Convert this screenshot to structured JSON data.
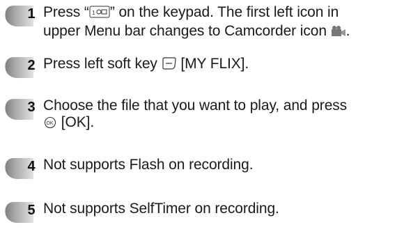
{
  "steps": [
    {
      "number": "1",
      "line1_a": "Press “",
      "icon1": "camcorder-key-icon",
      "line1_b": "” on the keypad. The first left icon in",
      "line2": "upper Menu bar changes to Camcorder icon",
      "icon2": "camcorder-icon",
      "line2_end": "."
    },
    {
      "number": "2",
      "text_a": "Press left soft key",
      "icon": "left-soft-key-icon",
      "text_b": "[MY FLIX]."
    },
    {
      "number": "3",
      "line1": "Choose the file that you want to play, and press",
      "icon": "ok-key-icon",
      "line2": "[OK]."
    },
    {
      "number": "4",
      "text": "Not supports Flash on recording."
    },
    {
      "number": "5",
      "text": "Not supports SelfTimer on recording."
    }
  ],
  "colors": {
    "badge_dark": "#8a8a8a",
    "badge_light": "#d6d6d6",
    "text": "#1a1a1a"
  }
}
